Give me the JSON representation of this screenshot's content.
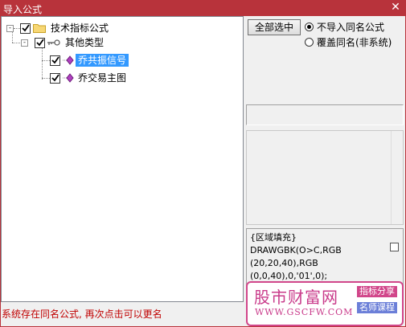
{
  "window": {
    "title": "导入公式",
    "close_glyph": "✕"
  },
  "tree": {
    "root": {
      "label": "技术指标公式",
      "checked": true,
      "expander": "-"
    },
    "group": {
      "label": "其他类型",
      "checked": true,
      "expander": "-"
    },
    "items": [
      {
        "label": "乔共振信号",
        "checked": true,
        "selected": true
      },
      {
        "label": "乔交易主图",
        "checked": true,
        "selected": false
      }
    ]
  },
  "controls": {
    "select_all_label": "全部选中",
    "radio_options": [
      {
        "label": "不导入同名公式",
        "selected": true
      },
      {
        "label": "覆盖同名(非系统)",
        "selected": false
      }
    ]
  },
  "code_preview": {
    "lines": [
      "{区域填充}",
      "DRAWGBK(O>C,RGB",
      "(20,20,40),RGB",
      "(0,0,40),0,'01',0);"
    ]
  },
  "status": {
    "message": "系统存在同名公式, 再次点击可以更名"
  },
  "watermark": {
    "site_name": "股市财富网",
    "url": "WWW.GSCFW.COM",
    "badge1": "指标分享",
    "badge2": "名师课程"
  },
  "colors": {
    "titlebar": "#b8333b",
    "selection": "#3399ff",
    "status_text": "#c00000",
    "watermark_pink": "#d1468a"
  }
}
